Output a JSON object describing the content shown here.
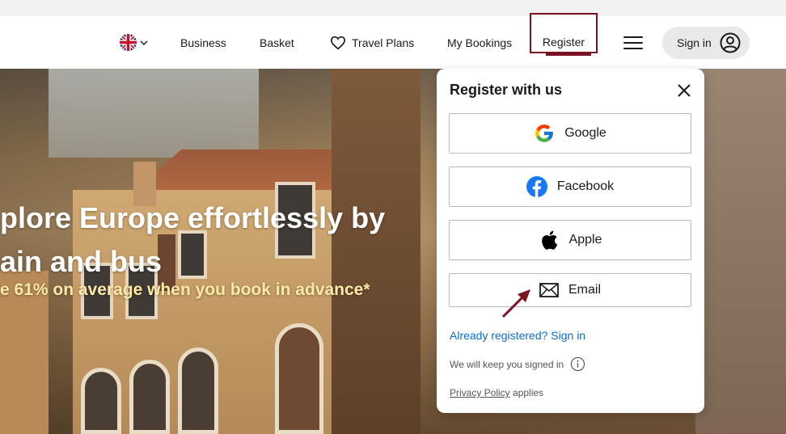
{
  "nav": {
    "language_icon": "uk-flag-icon",
    "items": [
      {
        "label": "Business"
      },
      {
        "label": "Basket"
      },
      {
        "label": "Travel Plans",
        "icon": "heart-icon"
      },
      {
        "label": "My Bookings"
      },
      {
        "label": "Register"
      }
    ],
    "menu_icon": "hamburger-menu-icon",
    "signin_label": "Sign in",
    "signin_icon": "user-circle-icon"
  },
  "hero": {
    "line1": "plore Europe effortlessly by",
    "line2": "ain and bus",
    "subtitle": "e 61% on average when you book in advance*"
  },
  "register_panel": {
    "title": "Register with us",
    "buttons": [
      {
        "label": "Google",
        "icon": "google-icon"
      },
      {
        "label": "Facebook",
        "icon": "facebook-icon"
      },
      {
        "label": "Apple",
        "icon": "apple-icon"
      },
      {
        "label": "Email",
        "icon": "envelope-icon"
      }
    ],
    "signin_link": "Already registered? Sign in",
    "keep_signed_in": "We will keep you signed in",
    "privacy_link": "Privacy Policy",
    "privacy_suffix": " applies"
  },
  "colors": {
    "accent": "#7a1220",
    "link": "#0a6cd1",
    "hero_subtitle": "#fde8a6",
    "signin_pill": "#e8e9eb"
  }
}
